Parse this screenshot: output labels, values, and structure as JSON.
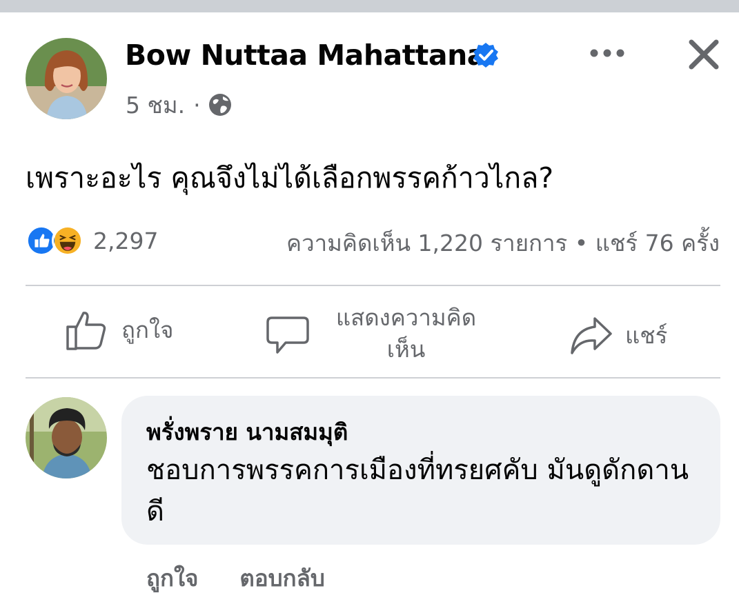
{
  "post": {
    "author": "Bow Nuttaa Mahattana",
    "time": "5 ชม.",
    "dot": "·",
    "text": "เพราะอะไร คุณจึงไม่ได้เลือกพรรคก้าวไกล?",
    "reaction_count": "2,297",
    "stats": "ความคิดเห็น 1,220 รายการ • แชร์ 76 ครั้ง"
  },
  "actions": {
    "like": "ถูกใจ",
    "comment_line1": "แสดงความคิด",
    "comment_line2": "เห็น",
    "share": "แชร์"
  },
  "comment": {
    "author": "พรั่งพราย นามสมมุติ",
    "text": "ชอบการพรรคการเมืองที่ทรยศคับ มันดูดักดานดี",
    "like": "ถูกใจ",
    "reply": "ตอบกลับ"
  },
  "colors": {
    "accent": "#1877f2",
    "secondary_text": "#65676b",
    "bubble": "#f0f2f5"
  }
}
